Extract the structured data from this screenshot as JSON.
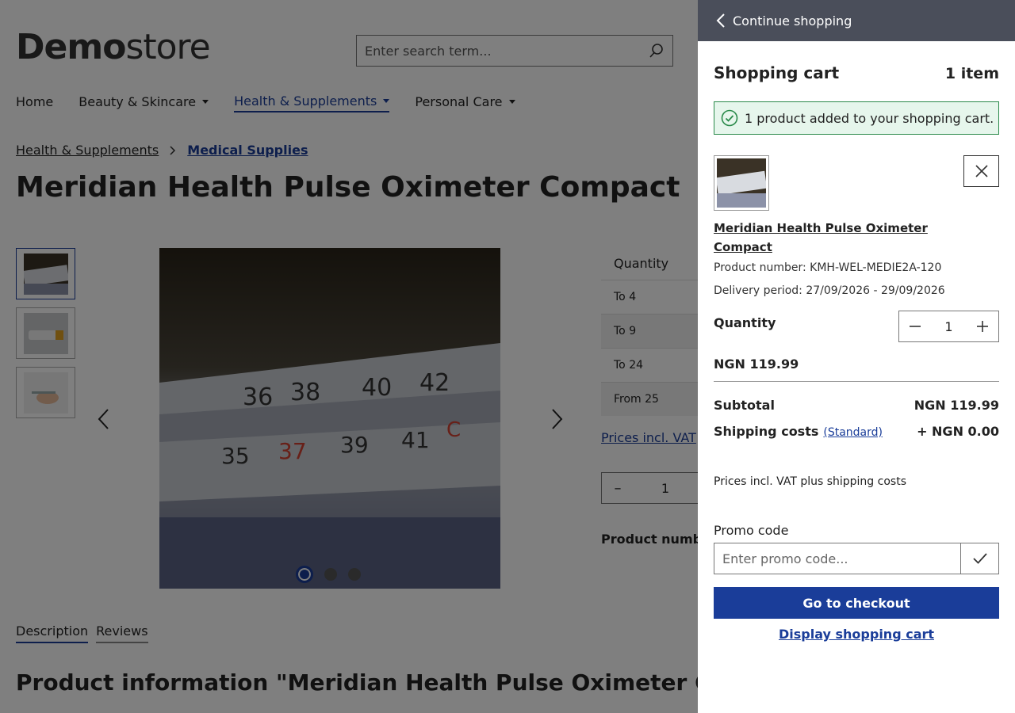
{
  "header": {
    "logo_bold": "Demo",
    "logo_rest": "store",
    "search_placeholder": "Enter search term..."
  },
  "nav": {
    "items": [
      {
        "label": "Home"
      },
      {
        "label": "Beauty & Skincare"
      },
      {
        "label": "Health & Supplements"
      },
      {
        "label": "Personal Care"
      }
    ]
  },
  "breadcrumb": {
    "items": [
      "Health & Supplements",
      "Medical Supplies"
    ]
  },
  "product": {
    "title": "Meridian Health Pulse Oximeter Compact",
    "quantity_header": "Quantity",
    "price_tiers": [
      "To 4",
      "To 9",
      "To 24",
      "From 25"
    ],
    "vat_link": "Prices incl. VAT",
    "qty_value": "1",
    "product_number_label": "Product number",
    "tabs": [
      "Description",
      "Reviews"
    ],
    "info_heading": "Product information \"Meridian Health Pulse Oximeter Compact"
  },
  "thermometer_scale": {
    "upper": [
      "36",
      "38",
      "40",
      "42"
    ],
    "lower": [
      "35",
      "37",
      "39",
      "41"
    ],
    "unit": "C"
  },
  "cart": {
    "back_label": "Continue shopping",
    "title": "Shopping cart",
    "count": "1 item",
    "alert": "1 product added to your shopping cart.",
    "line": {
      "name": "Meridian Health Pulse Oximeter Compact",
      "product_number": "Product number: KMH-WEL-MEDIE2A-120",
      "delivery": "Delivery period: 27/09/2026 - 29/09/2026",
      "quantity_label": "Quantity",
      "quantity": "1",
      "price": "NGN 119.99"
    },
    "subtotal_label": "Subtotal",
    "subtotal": "NGN 119.99",
    "shipping_label": "Shipping costs",
    "shipping_method": "(Standard)",
    "shipping": "+ NGN 0.00",
    "note": "Prices incl. VAT plus shipping costs",
    "promo_label": "Promo code",
    "promo_placeholder": "Enter promo code...",
    "checkout": "Go to checkout",
    "display_cart": "Display shopping cart"
  },
  "colors": {
    "accent": "#1a3d99",
    "offcanvas_header": "#4a4e5a",
    "success_border": "#2a8a4a",
    "success_bg": "#e6f6ec"
  }
}
